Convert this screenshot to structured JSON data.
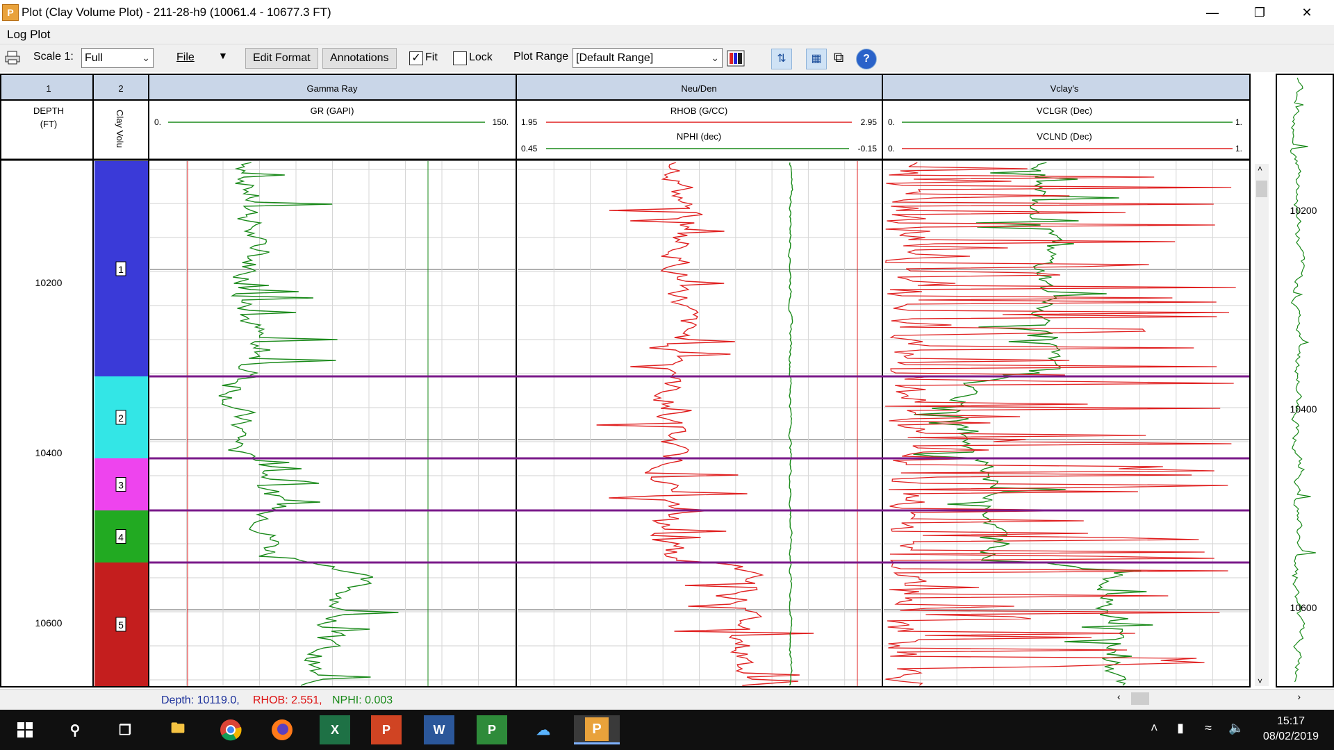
{
  "window": {
    "title": "Plot (Clay Volume Plot) - 211-28-h9 (10061.4 - 10677.3 FT)",
    "minimize_icon": "minimize-icon",
    "restore_icon": "restore-icon",
    "close_icon": "close-icon"
  },
  "menu": {
    "title": "Log Plot"
  },
  "toolbar": {
    "print_icon": "printer-icon",
    "scale_label": "Scale 1:",
    "scale_value": "Full",
    "file_label": "File",
    "edit_format_label": "Edit Format",
    "annotations_label": "Annotations",
    "fit_label": "Fit",
    "fit_checked": true,
    "lock_label": "Lock",
    "lock_checked": false,
    "plot_range_label": "Plot Range",
    "plot_range_value": "[Default Range]"
  },
  "tracks": {
    "track1": {
      "number": "1",
      "curve": "DEPTH",
      "unit": "(FT)"
    },
    "track2": {
      "number": "2",
      "curve": "Clay Volu"
    },
    "gamma": {
      "title": "Gamma Ray",
      "curve": "GR (GAPI)",
      "min": "0.",
      "max": "150."
    },
    "neuden": {
      "title": "Neu/Den",
      "curve1": "RHOB (G/CC)",
      "c1min": "1.95",
      "c1max": "2.95",
      "curve2": "NPHI (dec)",
      "c2min": "0.45",
      "c2max": "-0.15"
    },
    "vclay": {
      "title": "Vclay's",
      "curve1": "VCLGR (Dec)",
      "c1min": "0.",
      "c1max": "1.",
      "curve2": "VCLND (Dec)",
      "c2min": "0.",
      "c2max": "1."
    }
  },
  "depth_labels": [
    "10200",
    "10400",
    "10600"
  ],
  "zones": [
    {
      "label": "1",
      "color": "#3a3ad8"
    },
    {
      "label": "2",
      "color": "#33e6e6"
    },
    {
      "label": "3",
      "color": "#ee44ee"
    },
    {
      "label": "4",
      "color": "#22aa22"
    },
    {
      "label": "5",
      "color": "#c41e1e"
    }
  ],
  "minimap_labels": [
    "10200",
    "10400",
    "10600"
  ],
  "status": {
    "depth": "Depth: 10119.0,",
    "rhob": "RHOB: 2.551,",
    "nphi": "NPHI: 0.003"
  },
  "taskbar": {
    "time": "15:17",
    "date": "08/02/2019"
  }
}
